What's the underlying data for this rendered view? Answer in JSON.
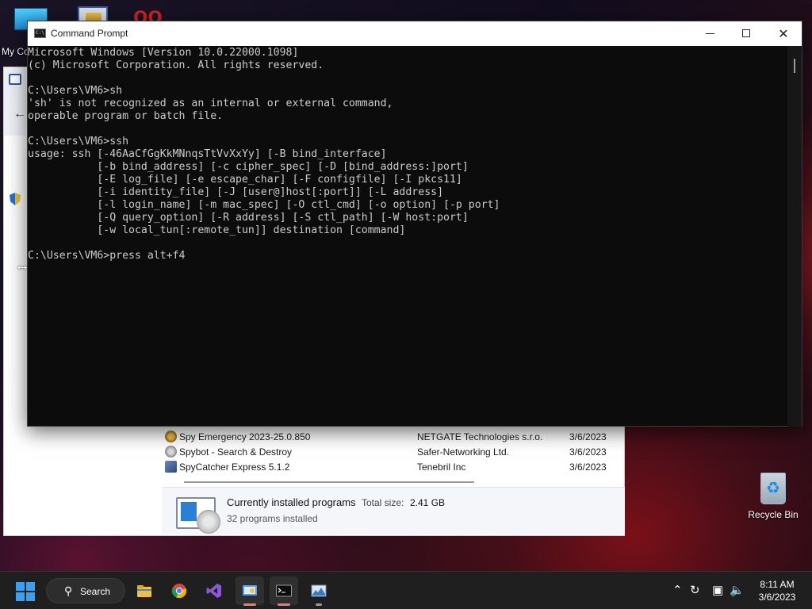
{
  "desktop": {
    "mycomp_label": "My Co",
    "recycle_label": "Recycle Bin"
  },
  "settings_window": {
    "programs": [
      {
        "name": "Spy Emergency 2023-25.0.850",
        "publisher": "NETGATE Technologies s.r.o.",
        "date": "3/6/2023",
        "icon": "spy-emergency-icon",
        "color": "#b8860b"
      },
      {
        "name": "Spybot - Search & Destroy",
        "publisher": "Safer-Networking Ltd.",
        "date": "3/6/2023",
        "icon": "spybot-icon",
        "color": "#8a8a8a"
      },
      {
        "name": "SpyCatcher Express 5.1.2",
        "publisher": "Tenebril Inc",
        "date": "3/6/2023",
        "icon": "spycatcher-icon",
        "color": "#4a6a9a"
      }
    ],
    "summary": {
      "title": "Currently installed programs",
      "total_size_label": "Total size:",
      "total_size_value": "2.41 GB",
      "count": "32 programs installed"
    }
  },
  "cmd": {
    "title": "Command Prompt",
    "lines": [
      "Microsoft Windows [Version 10.0.22000.1098]",
      "(c) Microsoft Corporation. All rights reserved.",
      "",
      "C:\\Users\\VM6>sh",
      "'sh' is not recognized as an internal or external command,",
      "operable program or batch file.",
      "",
      "C:\\Users\\VM6>ssh",
      "usage: ssh [-46AaCfGgKkMNnqsTtVvXxYy] [-B bind_interface]",
      "           [-b bind_address] [-c cipher_spec] [-D [bind_address:]port]",
      "           [-E log_file] [-e escape_char] [-F configfile] [-I pkcs11]",
      "           [-i identity_file] [-J [user@]host[:port]] [-L address]",
      "           [-l login_name] [-m mac_spec] [-O ctl_cmd] [-o option] [-p port]",
      "           [-Q query_option] [-R address] [-S ctl_path] [-W host:port]",
      "           [-w local_tun[:remote_tun]] destination [command]",
      "",
      "C:\\Users\\VM6>press alt+f4"
    ]
  },
  "taskbar": {
    "search_label": "Search",
    "apps": [
      "file-explorer-icon",
      "chrome-icon",
      "visual-studio-icon",
      "control-panel-icon",
      "command-prompt-icon",
      "resource-monitor-icon"
    ],
    "time": "8:11 AM",
    "date": "3/6/2023"
  }
}
